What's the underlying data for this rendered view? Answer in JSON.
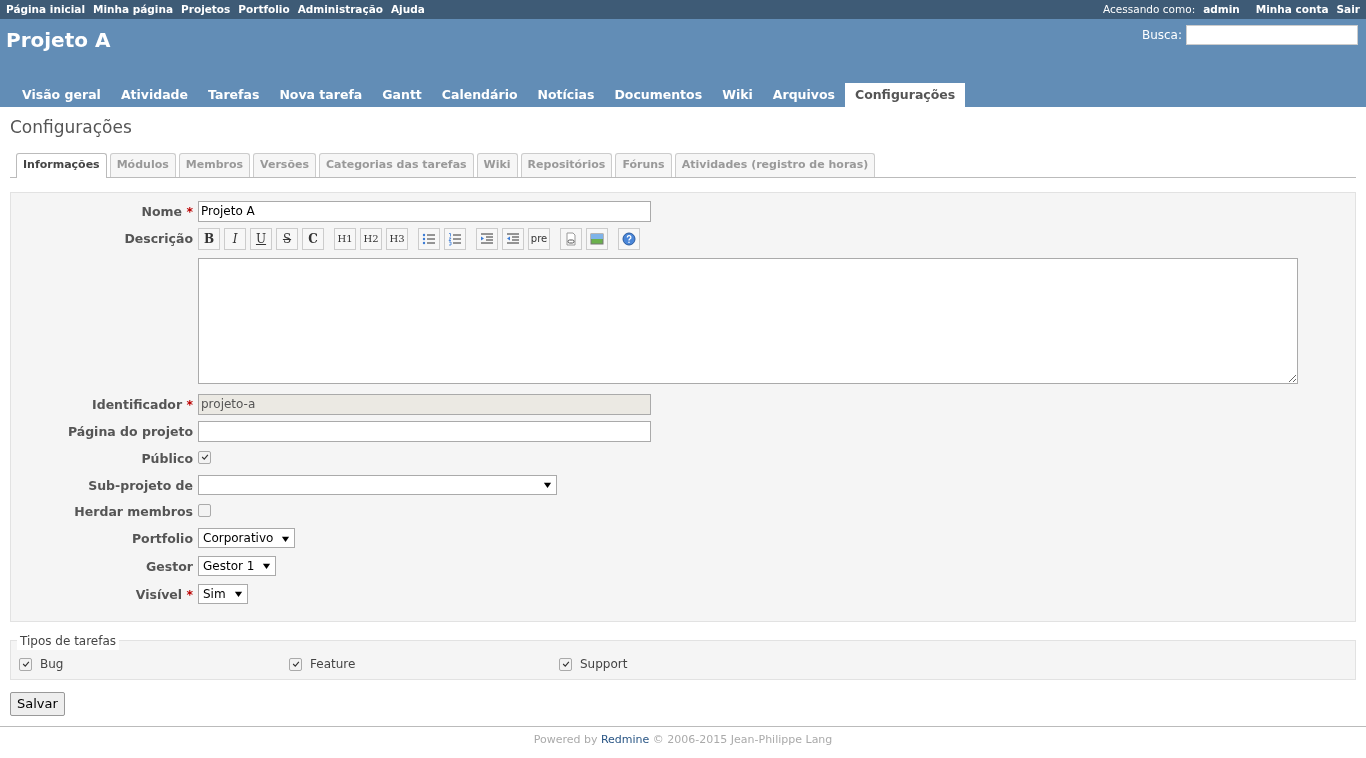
{
  "top_menu": {
    "items": [
      "Página inicial",
      "Minha página",
      "Projetos",
      "Portfolio",
      "Administração",
      "Ajuda"
    ],
    "logged_as_label": "Acessando como:",
    "user": "admin",
    "account_links": [
      "Minha conta",
      "Sair"
    ]
  },
  "header": {
    "title": "Projeto A",
    "search_label": "Busca:"
  },
  "main_menu": [
    {
      "label": "Visão geral",
      "selected": false
    },
    {
      "label": "Atividade",
      "selected": false
    },
    {
      "label": "Tarefas",
      "selected": false
    },
    {
      "label": "Nova tarefa",
      "selected": false
    },
    {
      "label": "Gantt",
      "selected": false
    },
    {
      "label": "Calendário",
      "selected": false
    },
    {
      "label": "Notícias",
      "selected": false
    },
    {
      "label": "Documentos",
      "selected": false
    },
    {
      "label": "Wiki",
      "selected": false
    },
    {
      "label": "Arquivos",
      "selected": false
    },
    {
      "label": "Configurações",
      "selected": true
    }
  ],
  "page_title": "Configurações",
  "required_mark": "*",
  "settings_tabs": [
    {
      "label": "Informações",
      "selected": true
    },
    {
      "label": "Módulos",
      "selected": false
    },
    {
      "label": "Membros",
      "selected": false
    },
    {
      "label": "Versões",
      "selected": false
    },
    {
      "label": "Categorias das tarefas",
      "selected": false
    },
    {
      "label": "Wiki",
      "selected": false
    },
    {
      "label": "Repositórios",
      "selected": false
    },
    {
      "label": "Fóruns",
      "selected": false
    },
    {
      "label": "Atividades (registro de horas)",
      "selected": false
    }
  ],
  "fields": [
    {
      "label": "Nome",
      "required": true,
      "kind": "text",
      "value": "Projeto A",
      "disabled": false
    },
    {
      "label": "Descrição",
      "required": false,
      "kind": "editor",
      "toolbar": [
        {
          "kind": "bold",
          "label": "B"
        },
        {
          "kind": "italic",
          "label": "I"
        },
        {
          "kind": "underline",
          "label": "U"
        },
        {
          "kind": "strike",
          "label": "S"
        },
        {
          "kind": "code",
          "label": "C"
        },
        {
          "kind": "heading",
          "label": "H1"
        },
        {
          "kind": "heading",
          "label": "H2"
        },
        {
          "kind": "heading",
          "label": "H3"
        },
        {
          "kind": "ul"
        },
        {
          "kind": "ol"
        },
        {
          "kind": "indent"
        },
        {
          "kind": "outdent"
        },
        {
          "kind": "pre",
          "label": "pre"
        },
        {
          "kind": "link"
        },
        {
          "kind": "image"
        },
        {
          "kind": "help"
        }
      ]
    },
    {
      "label": "Identificador",
      "required": true,
      "kind": "text",
      "value": "projeto-a",
      "disabled": true
    },
    {
      "label": "Página do projeto",
      "required": false,
      "kind": "text",
      "disabled": false
    },
    {
      "label": "Público",
      "required": false,
      "kind": "checkbox",
      "checked": true
    },
    {
      "label": "Sub-projeto de",
      "required": false,
      "kind": "select",
      "wide": true
    },
    {
      "label": "Herdar membros",
      "required": false,
      "kind": "checkbox",
      "checked": false
    },
    {
      "label": "Portfolio",
      "required": false,
      "kind": "select",
      "value": "Corporativo"
    },
    {
      "label": "Gestor",
      "required": false,
      "kind": "select",
      "value": "Gestor 1"
    },
    {
      "label": "Visível",
      "required": true,
      "kind": "select",
      "value": "Sim"
    }
  ],
  "tracker_types": {
    "legend": "Tipos de tarefas",
    "items": [
      {
        "label": "Bug",
        "checked": true
      },
      {
        "label": "Feature",
        "checked": true
      },
      {
        "label": "Support",
        "checked": true
      }
    ]
  },
  "save_button": "Salvar",
  "footer": {
    "before": "Powered by",
    "link": "Redmine",
    "after": "© 2006-2015 Jean-Philippe Lang"
  }
}
